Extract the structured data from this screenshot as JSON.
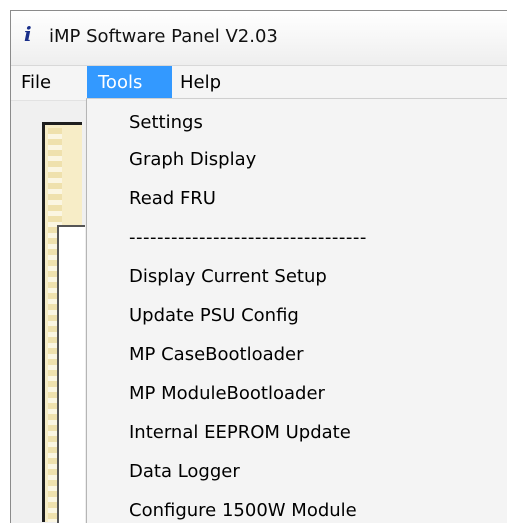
{
  "window": {
    "icon_glyph": "i",
    "title": "iMP Software Panel V2.03"
  },
  "menubar": {
    "file_label": "File",
    "tools_label": "Tools",
    "help_label": "Help",
    "active_menu": "Tools",
    "highlight_color": "#3399ff"
  },
  "tools_menu": {
    "items": [
      {
        "label": "Settings"
      },
      {
        "label": "Graph Display"
      },
      {
        "label": "Read FRU"
      },
      {
        "label": "----------------------------------",
        "separator": true
      },
      {
        "label": "Display Current Setup"
      },
      {
        "label": "Update PSU Config"
      },
      {
        "label": "MP CaseBootloader"
      },
      {
        "label": "MP ModuleBootloader"
      },
      {
        "label": "Internal EEPROM Update"
      },
      {
        "label": "Data Logger"
      },
      {
        "label": "Configure 1500W Module"
      }
    ]
  }
}
